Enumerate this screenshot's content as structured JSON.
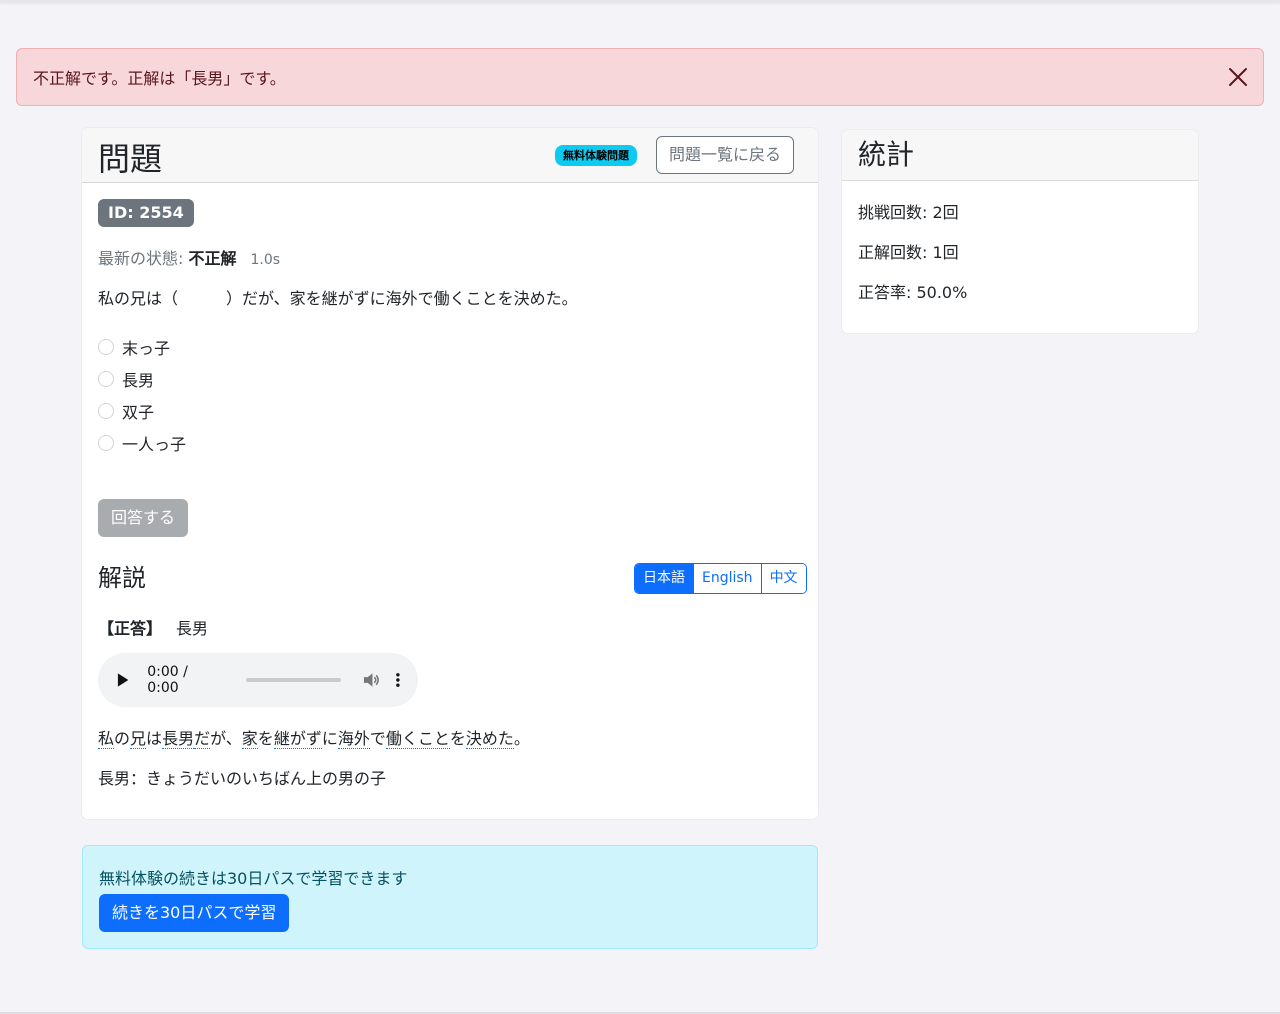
{
  "alert": {
    "message": "不正解です。正解は「長男」です。",
    "close_icon": "close-icon"
  },
  "question": {
    "title": "問題",
    "badge": "無料体験問題",
    "back_label": "問題一覧に戻る",
    "id_label": "ID: 2554",
    "status_label": "最新の状態: ",
    "status_value": "不正解",
    "time": "1.0s",
    "text": "私の兄は（　　　）だが、家を継がずに海外で働くことを決めた。",
    "options": [
      "末っ子",
      "長男",
      "双子",
      "一人っ子"
    ],
    "answer_label": "回答する"
  },
  "explanation": {
    "title": "解説",
    "languages": [
      "日本語",
      "English",
      "中文"
    ],
    "active_language": "日本語",
    "correct_label": "【正答】",
    "correct_value": "長男",
    "audio": {
      "time": "0:00 / 0:00"
    },
    "sentence_words": [
      "私",
      "の",
      "兄",
      "は",
      "長男",
      "だ",
      "が、",
      "家",
      "を",
      "継がず",
      "に",
      "海外",
      "で",
      "働くこと",
      "を",
      "決めた",
      "。"
    ],
    "definition": "長男：きょうだいのいちばん上の男の子"
  },
  "stats": {
    "title": "統計",
    "attempts": "挑戦回数: 2回",
    "correct": "正解回数: 1回",
    "rate": "正答率: 50.0%"
  },
  "promo": {
    "text": "無料体験の続きは30日パスで学習できます",
    "button": "続きを30日パスで学習"
  },
  "colors": {
    "primary": "#0d6efd",
    "danger_bg": "#f8d7da",
    "info_bg": "#cff4fc",
    "badge_info": "#0dcaf0",
    "secondary": "#6c757d"
  }
}
